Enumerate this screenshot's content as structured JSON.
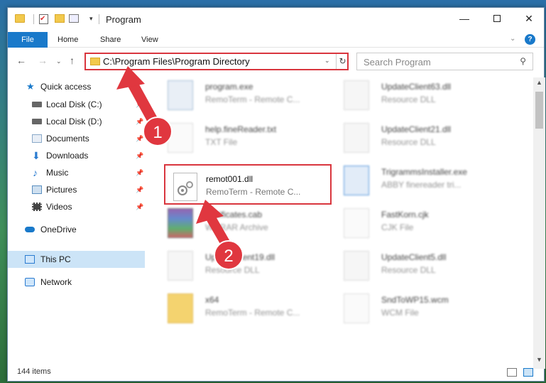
{
  "titlebar": {
    "title": "Program",
    "check_glyph": "✔",
    "minimize": "—",
    "close": "✕",
    "down": "▾"
  },
  "ribbon": {
    "tabs": [
      "File",
      "Home",
      "Share",
      "View"
    ],
    "chevron": "⌄",
    "help": "?"
  },
  "nav": {
    "back": "←",
    "forward": "→",
    "recent": "⌄",
    "up": "↑",
    "address": "C:\\Program Files\\Program Directory",
    "dropdown": "⌄",
    "refresh": "↻",
    "search_placeholder": "Search Program",
    "search_glyph": "⚲"
  },
  "sidebar": {
    "pin_glyph": "📌",
    "items": [
      {
        "label": "Quick access",
        "icon": "star-icon",
        "color": "#1979ca"
      },
      {
        "label": "Local Disk (C:)",
        "icon": "drive-icon",
        "color": "#555555",
        "pinned": true
      },
      {
        "label": "Local Disk (D:)",
        "icon": "drive-icon",
        "color": "#555555",
        "pinned": true
      },
      {
        "label": "Documents",
        "icon": "documents-icon",
        "color": "#8aa9c9",
        "pinned": true
      },
      {
        "label": "Downloads",
        "icon": "downloads-icon",
        "color": "#2a7bd0",
        "pinned": true
      },
      {
        "label": "Music",
        "icon": "music-icon",
        "color": "#2a7bd0",
        "pinned": true
      },
      {
        "label": "Pictures",
        "icon": "pictures-icon",
        "color": "#5a8fc0",
        "pinned": true
      },
      {
        "label": "Videos",
        "icon": "videos-icon",
        "color": "#444444",
        "pinned": true
      },
      {
        "label": "OneDrive",
        "icon": "onedrive-icon",
        "color": "#1979ca"
      },
      {
        "label": "This PC",
        "icon": "computer-icon",
        "color": "#2a7bd0",
        "selected": true
      },
      {
        "label": "Network",
        "icon": "network-icon",
        "color": "#2a7bd0"
      }
    ]
  },
  "files": [
    {
      "name": "program.exe",
      "type": "RemoTerm - Remote C...",
      "icon": "exe-icon"
    },
    {
      "name": "UpdateClient63.dll",
      "type": "Resource DLL",
      "icon": "dll-icon"
    },
    {
      "name": "help.fineReader.txt",
      "type": "TXT File",
      "icon": "text-file-icon"
    },
    {
      "name": "UpdateClient21.dll",
      "type": "Resource DLL",
      "icon": "dll-icon"
    },
    {
      "name": "remot001.dll",
      "type": "RemoTerm - Remote C...",
      "icon": "dll-gears-icon"
    },
    {
      "name": "TrigrammsInstaller.exe",
      "type": "ABBY finereader tri...",
      "icon": "installer-icon"
    },
    {
      "name": "certificates.cab",
      "type": "WinRAR Archive",
      "icon": "archive-icon"
    },
    {
      "name": "FastKorn.cjk",
      "type": "CJK File",
      "icon": "generic-file-icon"
    },
    {
      "name": "UpdateClient19.dll",
      "type": "Resource DLL",
      "icon": "dll-icon"
    },
    {
      "name": "UpdateClient5.dll",
      "type": "Resource DLL",
      "icon": "dll-icon"
    },
    {
      "name": "x64",
      "type": "RemoTerm - Remote C...",
      "icon": "folder-icon"
    },
    {
      "name": "SndToWP15.wcm",
      "type": "WCM File",
      "icon": "generic-file-icon"
    }
  ],
  "status": {
    "item_count": "144 items"
  },
  "scroll": {
    "up": "▲",
    "down": "▼"
  },
  "annotations": {
    "step1": "1",
    "step2": "2",
    "arrow_color": "#e0373f"
  }
}
